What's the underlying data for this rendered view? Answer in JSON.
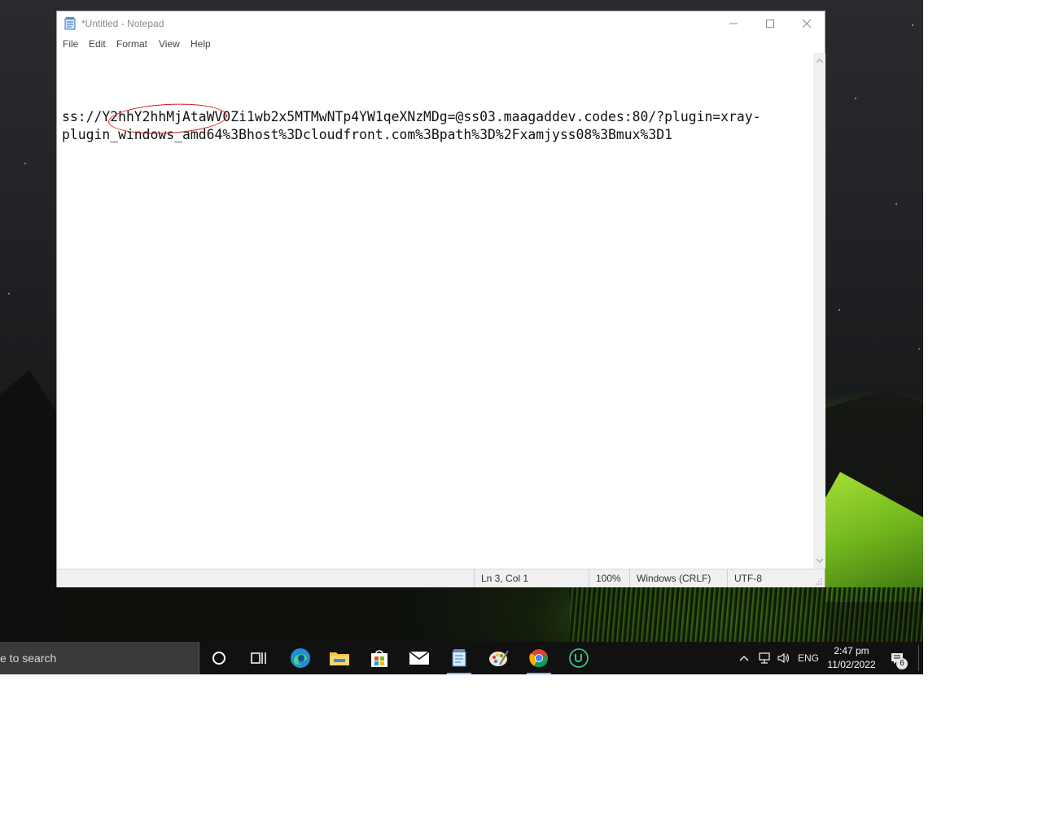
{
  "window": {
    "title": "*Untitled - Notepad",
    "app_icon": "notepad-icon",
    "controls": [
      "minimize-icon",
      "maximize-icon",
      "close-icon"
    ]
  },
  "menu": {
    "items": [
      "File",
      "Edit",
      "Format",
      "View",
      "Help"
    ]
  },
  "editor": {
    "line1": "",
    "line2": "ss://Y2hhY2hhMjAtaWV0Zi1wb2x5MTMwNTp4YW1qeXNzMDg=@ss03.maagaddev.codes:80/?plugin=xray-",
    "line3": "plugin_windows_amd64%3Bhost%3Dcloudfront.com%3Bpath%3D%2Fxamjyss08%3Bmux%3D1",
    "annotation_color": "#d21b1b"
  },
  "statusbar": {
    "position": "Ln 3, Col 1",
    "zoom": "100%",
    "line_ending": "Windows (CRLF)",
    "encoding": "UTF-8"
  },
  "taskbar": {
    "search_text": "e to search",
    "apps": [
      {
        "name": "cortana-icon"
      },
      {
        "name": "task-view-icon"
      },
      {
        "name": "edge-icon"
      },
      {
        "name": "file-explorer-icon"
      },
      {
        "name": "store-icon"
      },
      {
        "name": "mail-icon"
      },
      {
        "name": "notepad-icon",
        "active": true
      },
      {
        "name": "paint-icon"
      },
      {
        "name": "chrome-icon",
        "active": true
      },
      {
        "name": "upwork-icon"
      }
    ],
    "tray": {
      "language": "ENG",
      "time": "2:47 pm",
      "date": "11/02/2022",
      "notification_count": "6"
    }
  }
}
